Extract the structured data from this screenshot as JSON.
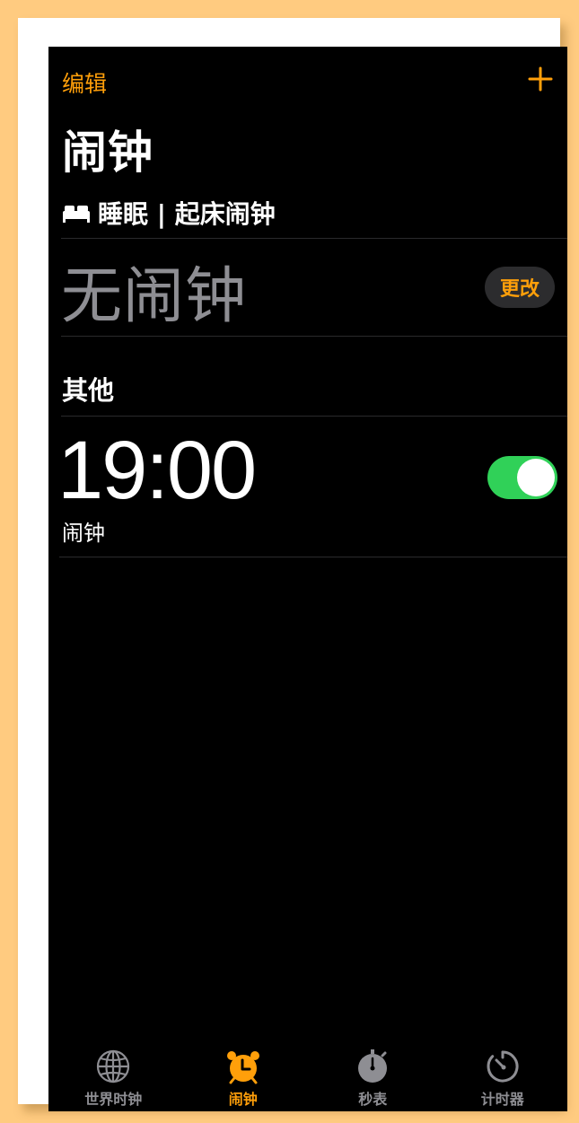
{
  "header": {
    "edit_label": "编辑",
    "add_icon": "plus-icon",
    "title": "闹钟"
  },
  "sleep": {
    "icon": "bed-icon",
    "title": "睡眠 | 起床闹钟",
    "status": "无闹钟",
    "change_label": "更改"
  },
  "other": {
    "title": "其他",
    "alarms": [
      {
        "time": "19:00",
        "label": "闹钟",
        "enabled": true
      }
    ]
  },
  "tabbar": {
    "tabs": [
      {
        "label": "世界时钟",
        "icon": "globe-icon",
        "active": false
      },
      {
        "label": "闹钟",
        "icon": "alarm-clock-icon",
        "active": true
      },
      {
        "label": "秒表",
        "icon": "stopwatch-icon",
        "active": false
      },
      {
        "label": "计时器",
        "icon": "timer-icon",
        "active": false
      }
    ]
  },
  "colors": {
    "accent": "#FF9F0A",
    "toggle_on": "#30D158",
    "background": "#000000",
    "secondary_text": "#8E8E93",
    "page_backdrop": "#FFCB80"
  }
}
